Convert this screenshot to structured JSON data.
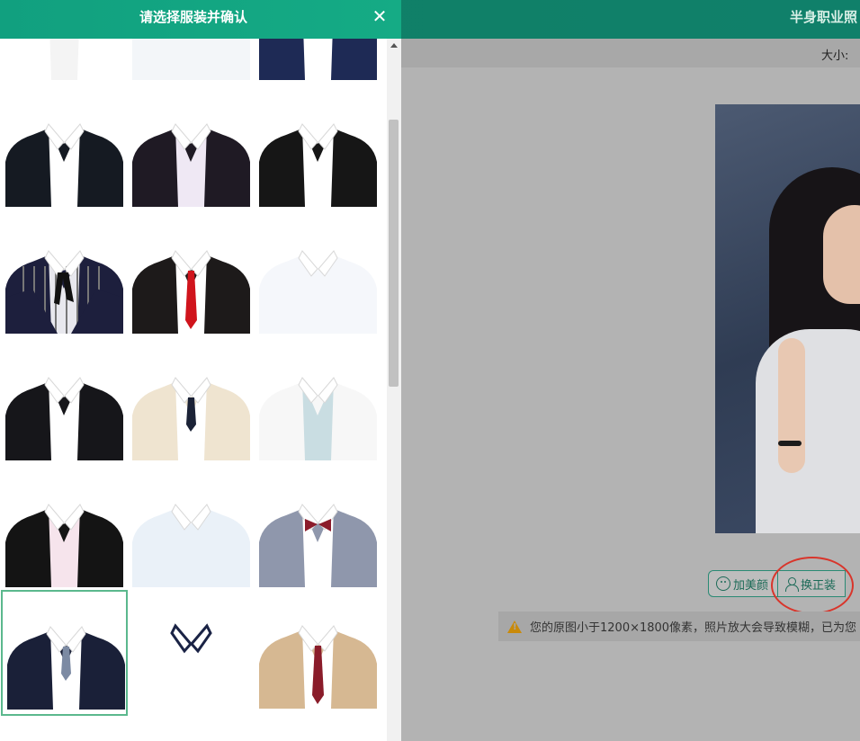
{
  "app": {
    "header_title": "半身职业照",
    "size_label": "大小:"
  },
  "actions": {
    "beauty_label": "加美颜",
    "change_suit_label": "换正装"
  },
  "notice": {
    "text": "您的原图小于1200×1800像素，照片放大会导致模糊，已为您"
  },
  "panel": {
    "title": "请选择服装并确认",
    "close_symbol": "✕"
  },
  "suits": [
    {
      "id": "white-shirt-red-bowtie",
      "jacket": "#ffffff",
      "shirt": "#f4f4f4",
      "tie": "bowtie",
      "tie_color": "#a52a3a",
      "partial": true
    },
    {
      "id": "white-shirt-plain",
      "jacket": "#f3f6f9",
      "shirt": "#f3f6f9",
      "tie": "none",
      "tie_color": "",
      "partial": true
    },
    {
      "id": "navy-blazer-blue-bow",
      "jacket": "#1e2a55",
      "shirt": "#ffffff",
      "tie": "bowtie",
      "tie_color": "#4a8bbd",
      "partial": true
    },
    {
      "id": "black-suit-white-shirt",
      "jacket": "#151a22",
      "shirt": "#ffffff",
      "tie": "none",
      "tie_color": ""
    },
    {
      "id": "black-suit-lilac-shirt",
      "jacket": "#1f1a24",
      "shirt": "#efe8f4",
      "tie": "none",
      "tie_color": ""
    },
    {
      "id": "black-suit-round-collar",
      "jacket": "#161616",
      "shirt": "#ffffff",
      "tie": "none",
      "tie_color": ""
    },
    {
      "id": "navy-vest-striped-shirt",
      "jacket": "#1d1f3d",
      "shirt": "#e8e8ee",
      "tie": "ribbon",
      "tie_color": "#111111",
      "striped": true
    },
    {
      "id": "black-suit-red-tie",
      "jacket": "#1d1a1a",
      "shirt": "#ffffff",
      "tie": "long",
      "tie_color": "#d0141c"
    },
    {
      "id": "white-round-collar-shirt",
      "jacket": "#f5f7fb",
      "shirt": "#f5f7fb",
      "tie": "none",
      "tie_color": ""
    },
    {
      "id": "black-suit-wide-collar",
      "jacket": "#16161a",
      "shirt": "#ffffff",
      "tie": "none",
      "tie_color": ""
    },
    {
      "id": "beige-vest-dark-tie",
      "jacket": "#efe4d0",
      "shirt": "#ffffff",
      "tie": "short",
      "tie_color": "#1b2236"
    },
    {
      "id": "white-blazer-blue-inner",
      "jacket": "#f7f7f7",
      "shirt": "#c9dde2",
      "tie": "none",
      "tie_color": ""
    },
    {
      "id": "black-suit-pink-shirt",
      "jacket": "#141414",
      "shirt": "#f6e4ec",
      "tie": "none",
      "tie_color": ""
    },
    {
      "id": "light-blue-shirt",
      "jacket": "#eaf1f8",
      "shirt": "#eaf1f8",
      "tie": "none",
      "tie_color": ""
    },
    {
      "id": "grey-blazer-red-bow",
      "jacket": "#8f97ac",
      "shirt": "#ffffff",
      "tie": "bowtie",
      "tie_color": "#8b1b2b"
    },
    {
      "id": "navy-vneck-vest-grey-tie",
      "jacket": "#1a2038",
      "shirt": "#ffffff",
      "tie": "short",
      "tie_color": "#7c8aa3",
      "selected": true
    },
    {
      "id": "white-shirt-navy-collar",
      "jacket": "#ffffff",
      "shirt": "#ffffff",
      "tie": "none",
      "tie_color": "",
      "collar_trim": "#1a2345"
    },
    {
      "id": "khaki-blazer-plaid-tie",
      "jacket": "#d6b892",
      "shirt": "#ffffff",
      "tie": "long",
      "tie_color": "#8a1c2a"
    }
  ]
}
